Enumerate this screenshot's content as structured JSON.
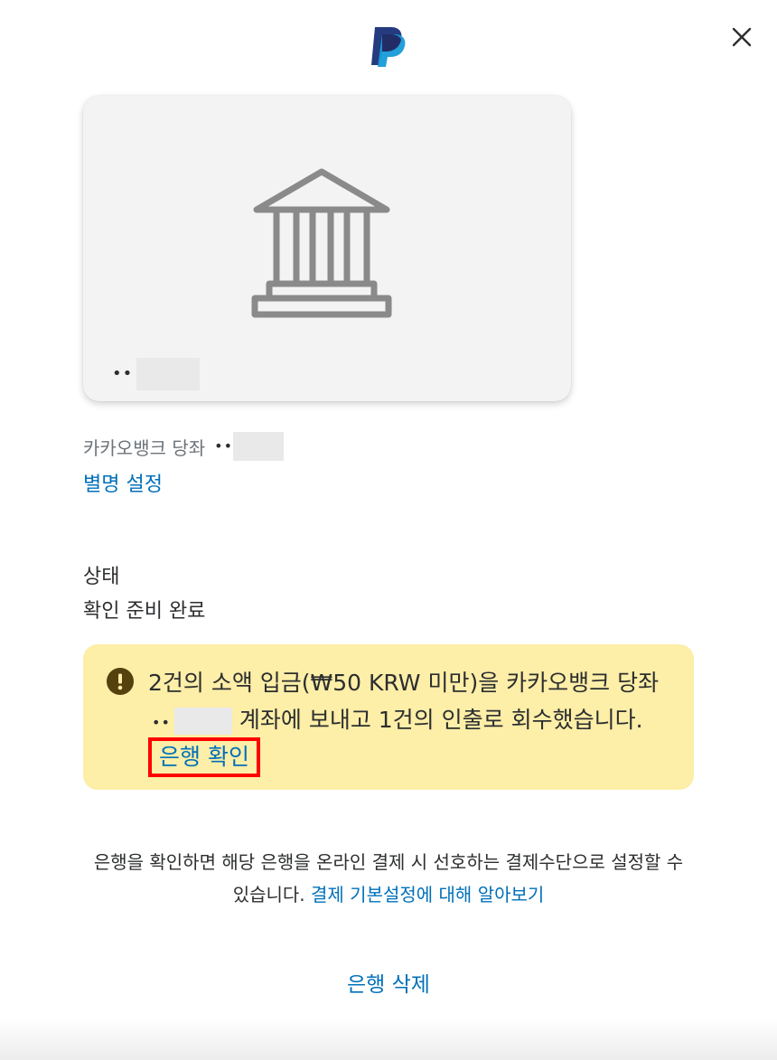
{
  "header": {
    "logo_icon": "paypal-logo-icon",
    "close_icon": "close-icon"
  },
  "card": {
    "icon": "bank-icon",
    "masked_number": "••"
  },
  "account": {
    "name": "카카오뱅크 당좌",
    "masked": "••"
  },
  "nickname_link": "별명 설정",
  "status": {
    "label": "상태",
    "value": "확인 준비 완료"
  },
  "alert": {
    "icon": "exclamation-icon",
    "text_part1": "2건의 소액 입금(₩50 KRW 미만)을 카카오뱅크 당좌",
    "masked": "••",
    "text_part2": "계좌에 보내고 1건의 인출로 회수했습니다.",
    "verify_link": "은행 확인",
    "color": "#fdeea8"
  },
  "preferences": {
    "text": "은행을 확인하면 해당 은행을 온라인 결제 시 선호하는 결제수단으로 설정할 수 있습니다.",
    "link": "결제 기본설정에 대해 알아보기"
  },
  "delete_button": "은행 삭제",
  "colors": {
    "link": "#0070ba",
    "highlight_border": "#ff0000",
    "card_bg": "#f3f3f3"
  }
}
